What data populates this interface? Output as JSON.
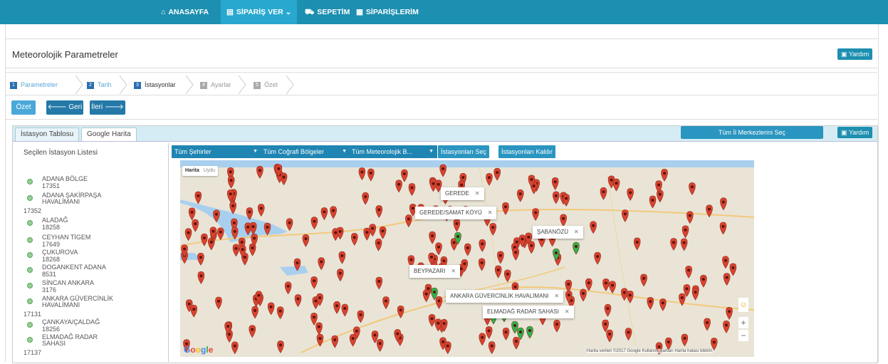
{
  "nav": {
    "home": "ANASAYFA",
    "order": "SİPARİŞ VER",
    "cart": "SEPETİM",
    "orders": "SİPARİŞLERİM"
  },
  "page": {
    "title": "Meteorolojik Parametreler",
    "help": "Yardım"
  },
  "steps": [
    {
      "num": "1",
      "label": "Parametreler"
    },
    {
      "num": "2",
      "label": "Tarih"
    },
    {
      "num": "3",
      "label": "İstasyonlar"
    },
    {
      "num": "4",
      "label": "Ayarlar"
    },
    {
      "num": "5",
      "label": "Özet"
    }
  ],
  "actions": {
    "summary": "Özet",
    "back": "Geri",
    "next": "İleri"
  },
  "tabs": {
    "table": "İstasyon Tablosu",
    "map": "Google Harita",
    "select_all": "Tüm İl Merkezlerini Seç",
    "help": "Yardım"
  },
  "list": {
    "title": "Seçilen İstasyon Listesi",
    "stations": [
      {
        "name": "ADANA BÖLGE",
        "code": "17351"
      },
      {
        "name": "ADANA ŞAKİRPAŞA HAVALİMANI",
        "code": "17352"
      },
      {
        "name": "ALADAĞ",
        "code": "18258"
      },
      {
        "name": "CEYHAN TİGEM",
        "code": "17649"
      },
      {
        "name": "ÇUKUROVA",
        "code": "18268"
      },
      {
        "name": "DOGANKENT ADANA",
        "code": "8531"
      },
      {
        "name": "SİNCAN ANKARA",
        "code": "3176"
      },
      {
        "name": "ANKARA GÜVERCİNLİK HAVALİMANI",
        "code": "17131"
      },
      {
        "name": "ÇANKAYA/ÇALDAĞ",
        "code": "18256"
      },
      {
        "name": "ELMADAĞ RADAR SAHASI",
        "code": "17137"
      }
    ]
  },
  "filters": {
    "cities": "Tüm Şehirler",
    "regions": "Tüm Coğrafi Bölgeler",
    "met": "Tüm Meteorolojik B...",
    "select": "İstasyonları Seç",
    "remove": "İstasyonları Kaldır"
  },
  "map": {
    "toggle_map": "Harita",
    "toggle_sat": "Uydu",
    "popups": [
      "GEREDE",
      "GEREDE/SAMAT KÖYÜ",
      "ŞABANÖZÜ",
      "BEYPAZARI",
      "ANKARA GÜVERCİNLİK HAVALİMANI",
      "ELMADAĞ RADAR SAHASI"
    ],
    "logo": "Google",
    "copyright": "Harita verileri ©2017 Google  Kullanım Şartları  Harita hatası bildirin",
    "zoom_in": "+",
    "zoom_out": "−",
    "marker_color": "#d9432f",
    "selected_color": "#2eb34a"
  }
}
